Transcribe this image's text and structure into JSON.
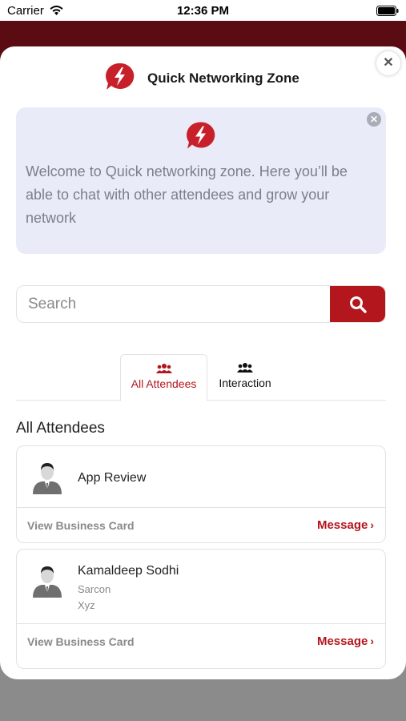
{
  "status_bar": {
    "carrier": "Carrier",
    "time": "12:36 PM"
  },
  "modal": {
    "title": "Quick Networking Zone",
    "close_symbol": "✕"
  },
  "welcome": {
    "text": "Welcome to Quick networking zone. Here you’ll be able to chat with other attendees and grow your network",
    "close_symbol": "✕"
  },
  "search": {
    "placeholder": "Search"
  },
  "tabs": [
    {
      "label": "All Attendees",
      "icon": "users-icon",
      "active": true
    },
    {
      "label": "Interaction",
      "icon": "users-icon",
      "active": false
    }
  ],
  "section_title": "All Attendees",
  "attendees": [
    {
      "name": "App Review",
      "company": "",
      "designation": "",
      "view_card": "View Business Card",
      "message": "Message"
    },
    {
      "name": "Kamaldeep Sodhi",
      "company": "Sarcon",
      "designation": "Xyz",
      "view_card": "View Business Card",
      "message": "Message"
    }
  ],
  "colors": {
    "accent": "#b3161d",
    "backdrop": "#5a0c12",
    "welcome_bg": "#e9ecf8"
  }
}
